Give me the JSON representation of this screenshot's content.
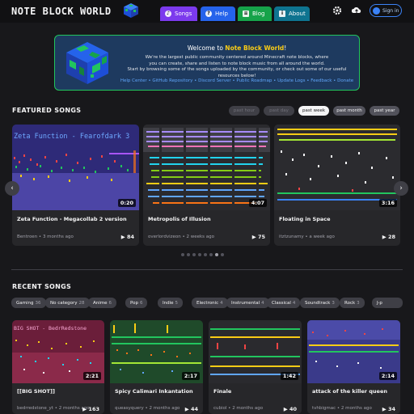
{
  "header": {
    "logo": "NOTE BLOCK WORLD",
    "tabs": [
      {
        "label": "Songs",
        "icon": "music-icon",
        "color": "#7c3aed"
      },
      {
        "label": "Help",
        "icon": "help-icon",
        "color": "#2563eb"
      },
      {
        "label": "Blog",
        "icon": "blog-icon",
        "color": "#16a34a"
      },
      {
        "label": "About",
        "icon": "about-icon",
        "color": "#0e7490"
      }
    ],
    "signin": "Sign in"
  },
  "welcome": {
    "prefix": "Welcome to ",
    "brand": "Note Block World",
    "suffix": "!",
    "line1": "We're the largest public community centered around Minecraft note blocks, where",
    "line2": "you can create, share and listen to note block music from all around the world.",
    "line3": "Start by browsing some of the songs uploaded by the community, or check out some of our useful resources below!",
    "links": "Help Center • GitHub Repository • Discord Server • Public Roadmap • Update Logs • Feedback • Donate"
  },
  "featured": {
    "title": "FEATURED SONGS",
    "filters": [
      "past hour",
      "past day",
      "past week",
      "past month",
      "past year"
    ],
    "selected_filter": "past week",
    "songs": [
      {
        "title": "Zeta Function - Megacollab 2 version",
        "author": "Bentroen",
        "time": "3 months ago",
        "plays": "84",
        "duration": "0:20",
        "thumb_text": "Zeta Function - Fearofdark 3"
      },
      {
        "title": "Metropolis of Illusion",
        "author": "overlordvizeon",
        "time": "2 weeks ago",
        "plays": "75",
        "duration": "4:07"
      },
      {
        "title": "Floating in Space",
        "author": "itztzunamy",
        "time": "a week ago",
        "plays": "28",
        "duration": "3:16"
      }
    ]
  },
  "recent": {
    "title": "RECENT SONGS",
    "categories": [
      {
        "name": "Gaming",
        "count": "36"
      },
      {
        "name": "No category",
        "count": "28"
      },
      {
        "name": "Anime",
        "count": "6"
      },
      {
        "name": "Pop",
        "count": "6"
      },
      {
        "name": "Indie",
        "count": "5"
      },
      {
        "name": "Electronic",
        "count": "4"
      },
      {
        "name": "Instrumental",
        "count": "4"
      },
      {
        "name": "Classical",
        "count": "4"
      },
      {
        "name": "Soundtrack",
        "count": "3"
      },
      {
        "name": "Rock",
        "count": "3"
      },
      {
        "name": "J-p",
        "count": ""
      }
    ],
    "songs": [
      {
        "title": "[[BIG SHOT]]",
        "author": "bedrredstone_yt",
        "time": "2 months ago",
        "plays": "163",
        "duration": "2:21",
        "thumb_text": "BIG SHOT - BedrRedstone"
      },
      {
        "title": "Spicy Calimari Inkantation",
        "author": "queasyquery",
        "time": "2 months ago",
        "plays": "44",
        "duration": "2:17"
      },
      {
        "title": "Finale",
        "author": "cubiol",
        "time": "2 months ago",
        "plays": "40",
        "duration": "1:42"
      },
      {
        "title": "attack of the killer queen",
        "author": "tvhbigmac",
        "time": "2 months ago",
        "plays": "34",
        "duration": "2:14"
      }
    ]
  }
}
